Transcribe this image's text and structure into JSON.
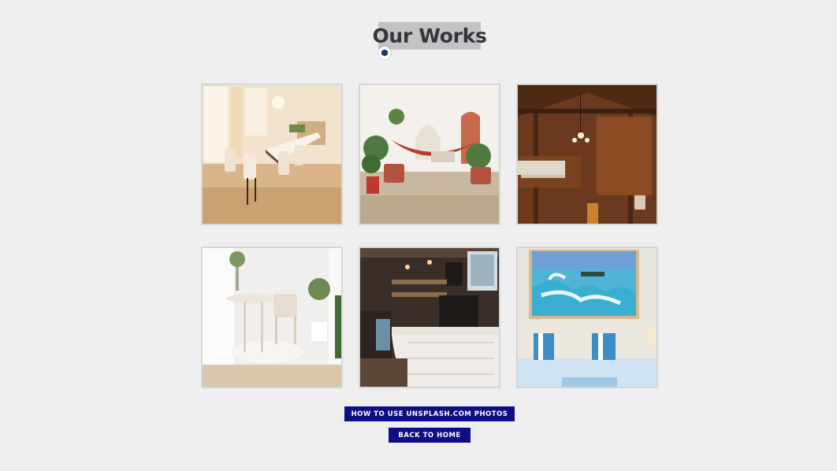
{
  "header": {
    "title": "Our Works"
  },
  "gallery": {
    "items": [
      {
        "icon": "dining-room-photo"
      },
      {
        "icon": "hammock-living-room-photo"
      },
      {
        "icon": "wooden-hall-photo"
      },
      {
        "icon": "white-table-room-photo"
      },
      {
        "icon": "cafe-counter-photo"
      },
      {
        "icon": "bedroom-seascape-photo"
      }
    ]
  },
  "actions": {
    "unsplash_label": "HOW TO USE UNSPLASH.COM PHOTOS",
    "home_label": "BACK TO HOME"
  },
  "colors": {
    "background": "#f0efef",
    "title_highlight": "#c3c3c3",
    "title_text": "#33373d",
    "button_bg": "#0d0d84",
    "button_text": "#ffffff"
  }
}
